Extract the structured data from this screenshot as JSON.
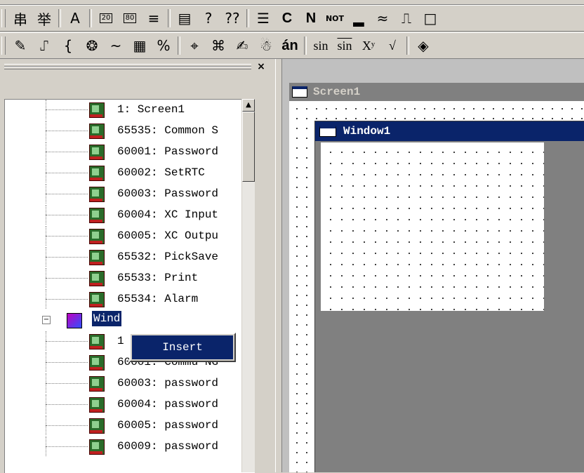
{
  "toolbar1": {
    "buttons": [
      "串",
      "举",
      "A",
      "20",
      "80",
      "≡",
      "▤",
      "?",
      "??",
      "☰",
      "C",
      "N",
      "NOT",
      "▂",
      "≈",
      "⎍",
      "□"
    ]
  },
  "toolbar2": {
    "buttons": [
      "✎",
      "⑀",
      "{",
      "❂",
      "~",
      "▦",
      "%",
      "⌖",
      "⌘",
      "✍",
      "☃",
      "án",
      "sin",
      "sin",
      "Xʸ",
      "√",
      "◈"
    ]
  },
  "panel": {
    "close_label": "×"
  },
  "tree": {
    "screens": [
      "1: Screen1",
      "65535: Common S",
      "60001: Password",
      "60002: SetRTC",
      "60003: Password",
      "60004: XC Input",
      "60005: XC Outpu",
      "65532: PickSave",
      "65533: Print",
      "65534: Alarm"
    ],
    "window_group": {
      "expander": "−",
      "label": "Wind"
    },
    "windows": [
      "1",
      "60001: Commu NG",
      "60003: password",
      "60004: password",
      "60005: password",
      "60009: password"
    ]
  },
  "context_menu": {
    "insert_label": "Insert"
  },
  "design": {
    "screen_title": "Screen1",
    "window_title": "Window1"
  },
  "scroll": {
    "up_arrow": "▲"
  }
}
